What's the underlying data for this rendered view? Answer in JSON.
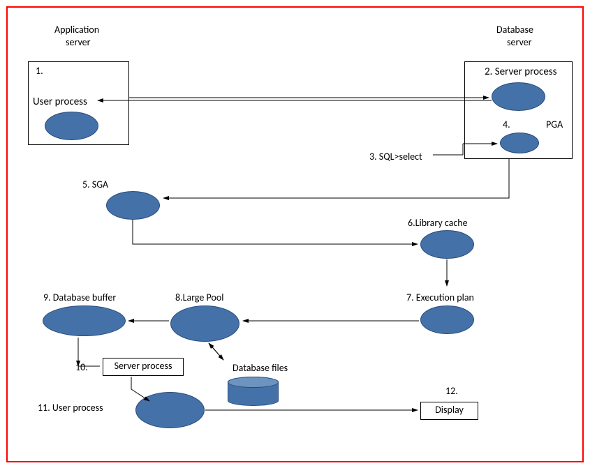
{
  "title_left_line1": "Application",
  "title_left_line2": "server",
  "title_right_line1": "Database",
  "title_right_line2": "server",
  "step1_box_num": "1.",
  "step1_label": "User process",
  "step2_label": "2. Server process",
  "step3_label": "3. SQL>select",
  "step4_num": "4.",
  "step4_label": "PGA",
  "step5_label": "5. SGA",
  "step6_label": "6.Library cache",
  "step7_label": "7. Execution plan",
  "step8_label": "8.Large Pool",
  "step9_label": "9. Database buffer",
  "step10_num": "10.",
  "step10_box": "Server process",
  "dbfiles_label": "Database files",
  "step11_label": "11.  User process",
  "step12_num": "12.",
  "step12_box": "Display"
}
